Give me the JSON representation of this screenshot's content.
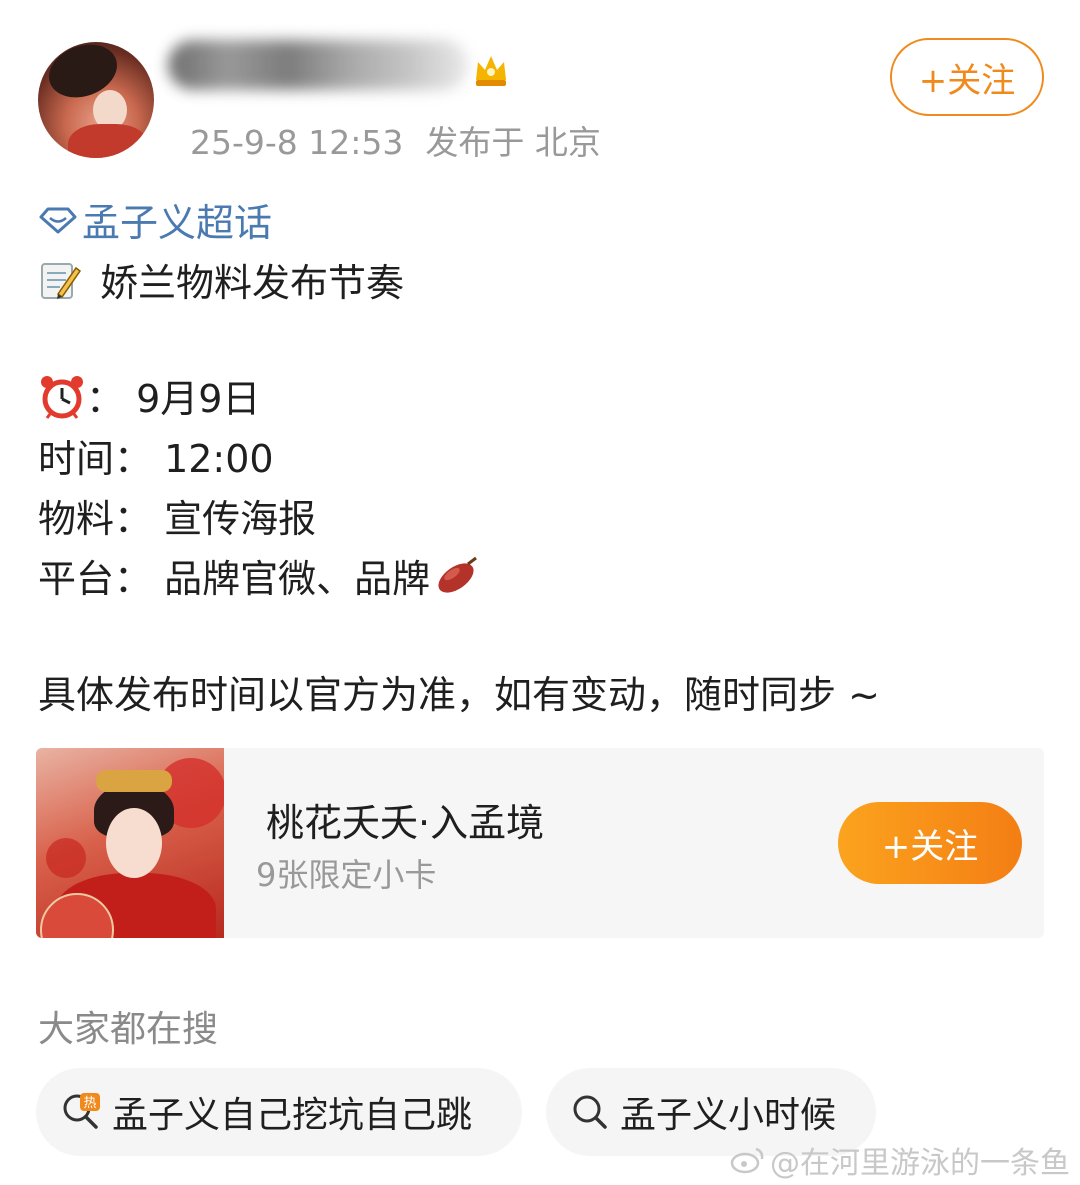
{
  "header": {
    "timestamp": "25-9-8 12:53",
    "location": "发布于 北京",
    "follow_label": "+关注"
  },
  "post": {
    "topic": "孟子义超话",
    "lines": [
      "娇兰物料发布节奏",
      "：  9月9日",
      "时间：  12:00",
      "物料：  宣传海报",
      "平台：  品牌官微、品牌",
      "具体发布时间以官方为准，如有变动，随时同步 ~"
    ]
  },
  "card": {
    "title": "桃花夭夭·入孟境",
    "subtitle": "9张限定小卡",
    "follow_label": "+关注"
  },
  "search": {
    "title": "大家都在搜",
    "chips": [
      "孟子义自己挖坑自己跳",
      "孟子义小时候"
    ]
  },
  "watermark": "@在河里游泳的一条鱼",
  "colors": {
    "accent_orange": "#f08a1c",
    "topic_blue": "#4a7ab0",
    "meta_gray": "#999999"
  }
}
